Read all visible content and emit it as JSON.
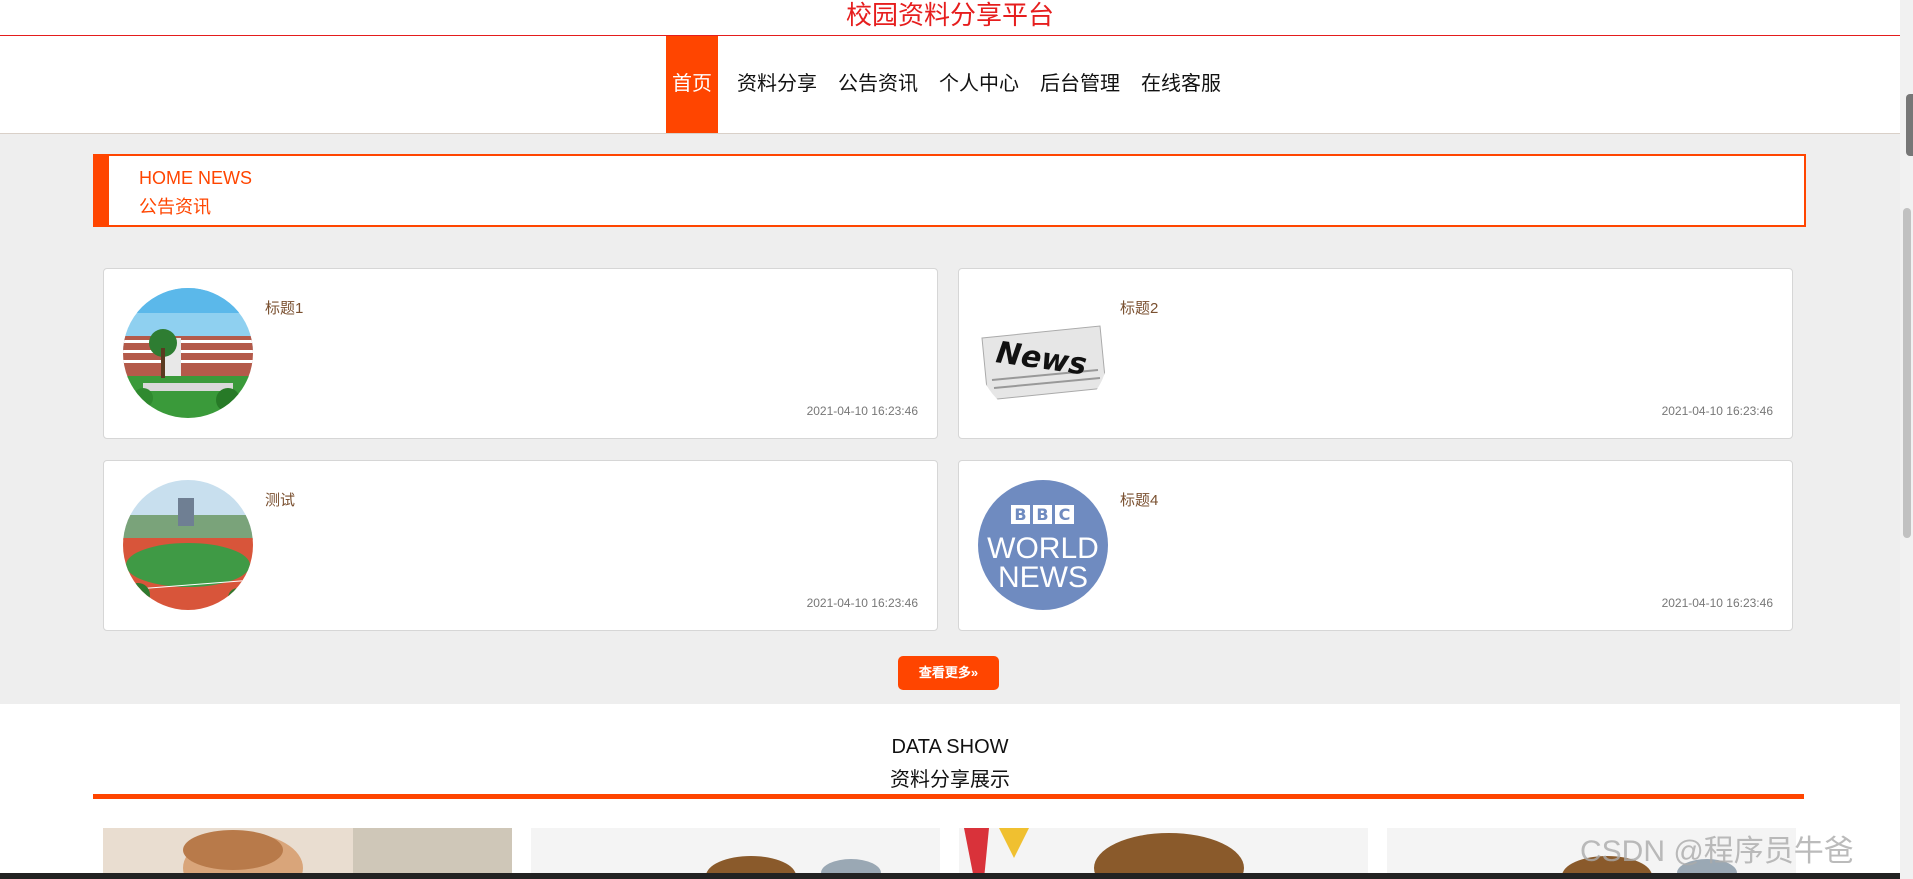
{
  "site": {
    "title": "校园资料分享平台"
  },
  "nav": {
    "items": [
      {
        "label": "首页",
        "active": true
      },
      {
        "label": "资料分享",
        "active": false
      },
      {
        "label": "公告资讯",
        "active": false
      },
      {
        "label": "个人中心",
        "active": false
      },
      {
        "label": "后台管理",
        "active": false
      },
      {
        "label": "在线客服",
        "active": false
      }
    ]
  },
  "news_section": {
    "heading_en": "HOME NEWS",
    "heading_cn": "公告资讯",
    "items": [
      {
        "title": "标题1",
        "time": "2021-04-10 16:23:46",
        "thumb": "campus-building-image"
      },
      {
        "title": "标题2",
        "time": "2021-04-10 16:23:46",
        "thumb": "newspaper-news-image"
      },
      {
        "title": "测试",
        "time": "2021-04-10 16:23:46",
        "thumb": "sports-field-image"
      },
      {
        "title": "标题4",
        "time": "2021-04-10 16:23:46",
        "thumb": "bbc-world-news-logo"
      }
    ],
    "more_label": "查看更多»"
  },
  "data_show": {
    "heading_en": "DATA SHOW",
    "heading_cn": "资料分享展示"
  },
  "newspaper_text": "News",
  "bbc_logo": {
    "letters": [
      "B",
      "B",
      "C"
    ],
    "line1": "WORLD",
    "line2": "NEWS"
  },
  "watermark": "CSDN @程序员牛爸",
  "colors": {
    "accent": "#ff4500",
    "title_red": "#e61e1e",
    "news_bg": "#eeeeee",
    "bbc_blue": "#6f8bc0"
  }
}
